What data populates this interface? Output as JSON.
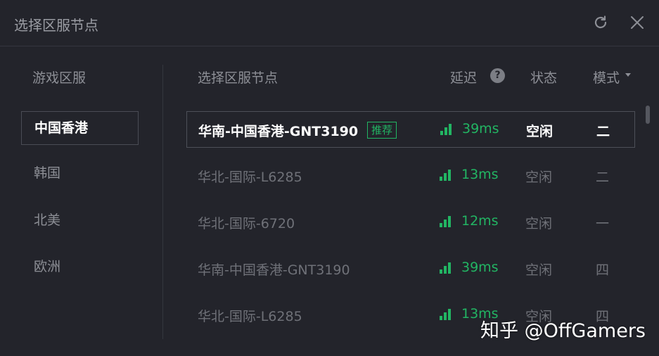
{
  "window": {
    "title": "选择区服节点",
    "refresh_icon": "refresh-icon",
    "close_icon": "close-icon"
  },
  "sidebar": {
    "header": "游戏区服",
    "items": [
      {
        "label": "中国香港",
        "selected": true
      },
      {
        "label": "韩国",
        "selected": false
      },
      {
        "label": "北美",
        "selected": false
      },
      {
        "label": "欧洲",
        "selected": false
      }
    ]
  },
  "table": {
    "columns": {
      "node": "选择区服节点",
      "latency": "延迟",
      "latency_help_icon": "?",
      "status": "状态",
      "mode": "模式"
    },
    "rows": [
      {
        "name": "华南-中国香港-GNT3190",
        "badge": "推荐",
        "ping": "39ms",
        "status": "空闲",
        "mode": "二",
        "selected": true
      },
      {
        "name": "华北-国际-L6285",
        "badge": "",
        "ping": "13ms",
        "status": "空闲",
        "mode": "二",
        "selected": false
      },
      {
        "name": "华北-国际-6720",
        "badge": "",
        "ping": "12ms",
        "status": "空闲",
        "mode": "一",
        "selected": false
      },
      {
        "name": "华南-中国香港-GNT3190",
        "badge": "",
        "ping": "39ms",
        "status": "空闲",
        "mode": "四",
        "selected": false
      },
      {
        "name": "华北-国际-L6285",
        "badge": "",
        "ping": "13ms",
        "status": "空闲",
        "mode": "四",
        "selected": false
      }
    ]
  },
  "colors": {
    "background": "#23242b",
    "accent_green": "#22b563",
    "text_active": "#ffffff",
    "text_muted": "#6f7178"
  },
  "watermark": "知乎 @OffGamers"
}
